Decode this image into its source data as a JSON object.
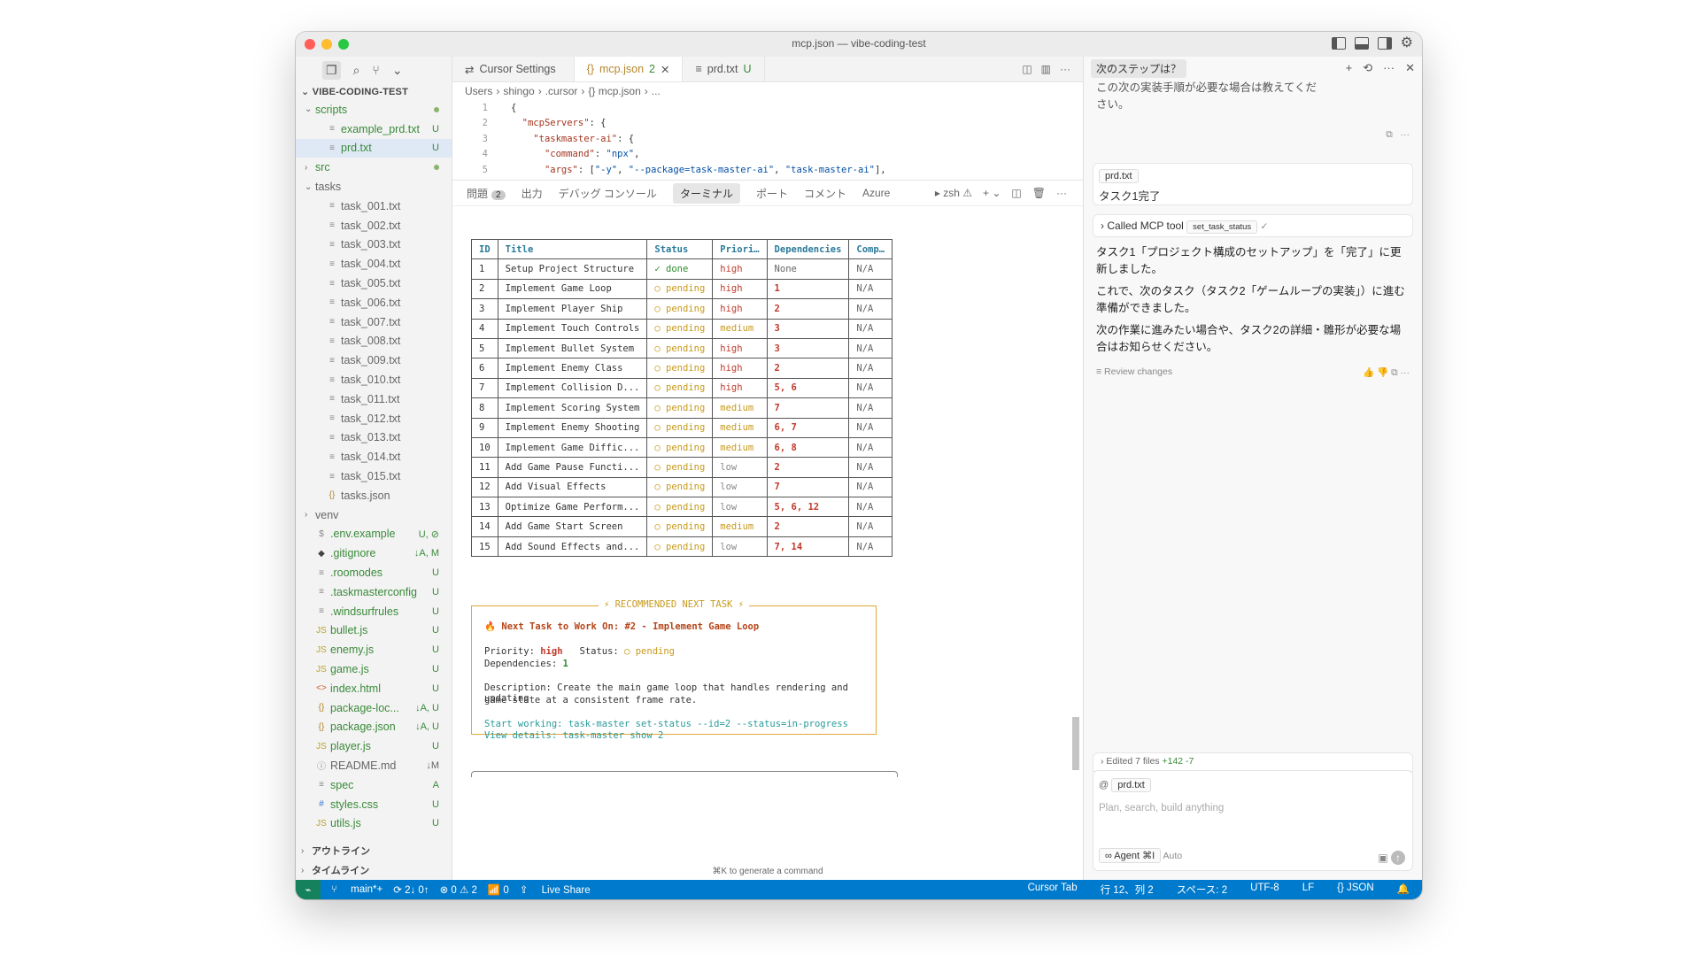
{
  "window": {
    "title": "mcp.json — vibe-coding-test"
  },
  "explorer": {
    "section_title": "VIBE-CODING-TEST",
    "items": [
      {
        "name": "scripts",
        "kind": "folder-open",
        "status": "●",
        "color": "green"
      },
      {
        "name": "example_prd.txt",
        "kind": "file",
        "status": "U",
        "color": "green"
      },
      {
        "name": "prd.txt",
        "kind": "file",
        "status": "U",
        "color": "green",
        "selected": true
      },
      {
        "name": "src",
        "kind": "folder",
        "status": "●",
        "color": "green"
      },
      {
        "name": "tasks",
        "kind": "folder-open",
        "status": "",
        "color": "grey"
      },
      {
        "name": "task_001.txt",
        "kind": "file",
        "status": "",
        "color": "grey"
      },
      {
        "name": "task_002.txt",
        "kind": "file",
        "status": "",
        "color": "grey"
      },
      {
        "name": "task_003.txt",
        "kind": "file",
        "status": "",
        "color": "grey"
      },
      {
        "name": "task_004.txt",
        "kind": "file",
        "status": "",
        "color": "grey"
      },
      {
        "name": "task_005.txt",
        "kind": "file",
        "status": "",
        "color": "grey"
      },
      {
        "name": "task_006.txt",
        "kind": "file",
        "status": "",
        "color": "grey"
      },
      {
        "name": "task_007.txt",
        "kind": "file",
        "status": "",
        "color": "grey"
      },
      {
        "name": "task_008.txt",
        "kind": "file",
        "status": "",
        "color": "grey"
      },
      {
        "name": "task_009.txt",
        "kind": "file",
        "status": "",
        "color": "grey"
      },
      {
        "name": "task_010.txt",
        "kind": "file",
        "status": "",
        "color": "grey"
      },
      {
        "name": "task_011.txt",
        "kind": "file",
        "status": "",
        "color": "grey"
      },
      {
        "name": "task_012.txt",
        "kind": "file",
        "status": "",
        "color": "grey"
      },
      {
        "name": "task_013.txt",
        "kind": "file",
        "status": "",
        "color": "grey"
      },
      {
        "name": "task_014.txt",
        "kind": "file",
        "status": "",
        "color": "grey"
      },
      {
        "name": "task_015.txt",
        "kind": "file",
        "status": "",
        "color": "grey"
      },
      {
        "name": "tasks.json",
        "kind": "json",
        "status": "",
        "color": "grey"
      },
      {
        "name": "venv",
        "kind": "folder",
        "status": "",
        "color": "grey"
      },
      {
        "name": ".env.example",
        "kind": "env",
        "status": "U, ⊘",
        "color": "green"
      },
      {
        "name": ".gitignore",
        "kind": "git",
        "status": "↓A, M",
        "color": "green"
      },
      {
        "name": ".roomodes",
        "kind": "file",
        "status": "U",
        "color": "green"
      },
      {
        "name": ".taskmasterconfig",
        "kind": "file",
        "status": "U",
        "color": "green"
      },
      {
        "name": ".windsurfrules",
        "kind": "file",
        "status": "U",
        "color": "green"
      },
      {
        "name": "bullet.js",
        "kind": "js",
        "status": "U",
        "color": "green"
      },
      {
        "name": "enemy.js",
        "kind": "js",
        "status": "U",
        "color": "green"
      },
      {
        "name": "game.js",
        "kind": "js",
        "status": "U",
        "color": "green"
      },
      {
        "name": "index.html",
        "kind": "html",
        "status": "U",
        "color": "green"
      },
      {
        "name": "package-loc...",
        "kind": "json",
        "status": "↓A, U",
        "color": "green"
      },
      {
        "name": "package.json",
        "kind": "json",
        "status": "↓A, U",
        "color": "green"
      },
      {
        "name": "player.js",
        "kind": "js",
        "status": "U",
        "color": "green"
      },
      {
        "name": "README.md",
        "kind": "info",
        "status": "↓M",
        "color": "grey"
      },
      {
        "name": "spec",
        "kind": "file",
        "status": "A",
        "color": "green"
      },
      {
        "name": "styles.css",
        "kind": "css",
        "status": "U",
        "color": "green"
      },
      {
        "name": "utils.js",
        "kind": "js",
        "status": "U",
        "color": "green"
      }
    ],
    "outline": "アウトライン",
    "timeline": "タイムライン"
  },
  "tabs": [
    {
      "label": "Cursor Settings",
      "icon": "⇄",
      "suffix": "",
      "active": false
    },
    {
      "label": "mcp.json",
      "icon": "{}",
      "suffix": "2",
      "active": true
    },
    {
      "label": "prd.txt",
      "icon": "≡",
      "suffix": "U",
      "active": false
    }
  ],
  "breadcrumb": [
    "Users",
    "shingo",
    ".cursor",
    "{} mcp.json",
    "..."
  ],
  "code_lines": [
    {
      "n": "1",
      "html": "{"
    },
    {
      "n": "2",
      "html": "  <span class='str'>\"mcpServers\"</span>: {"
    },
    {
      "n": "3",
      "html": "    <span class='str'>\"taskmaster-ai\"</span>: {"
    },
    {
      "n": "4",
      "html": "      <span class='str'>\"command\"</span>: <span class='key'>\"npx\"</span>,"
    },
    {
      "n": "5",
      "html": "      <span class='str'>\"args\"</span>: [<span class='key'>\"-y\"</span>, <span class='key'>\"--package=task-master-ai\"</span>, <span class='key'>\"task-master-ai\"</span>],"
    },
    {
      "n": "6",
      "html": "      <span class='str'>\"env\"</span>: {"
    }
  ],
  "panel": {
    "tabs": [
      "問題",
      "出力",
      "デバッグ コンソール",
      "ターミナル",
      "ポート",
      "コメント",
      "Azure"
    ],
    "problems_count": "2",
    "active": "ターミナル",
    "shell": "zsh"
  },
  "task_table": {
    "headers": [
      "ID",
      "Title",
      "Status",
      "Priori…",
      "Dependencies",
      "Comp…"
    ],
    "rows": [
      [
        "1",
        "Setup Project Structure",
        "✓ done",
        "high",
        "None",
        "N/A"
      ],
      [
        "2",
        "Implement Game Loop",
        "○ pending",
        "high",
        "1",
        "N/A"
      ],
      [
        "3",
        "Implement Player Ship",
        "○ pending",
        "high",
        "2",
        "N/A"
      ],
      [
        "4",
        "Implement Touch Controls",
        "○ pending",
        "medium",
        "3",
        "N/A"
      ],
      [
        "5",
        "Implement Bullet System",
        "○ pending",
        "high",
        "3",
        "N/A"
      ],
      [
        "6",
        "Implement Enemy Class",
        "○ pending",
        "high",
        "2",
        "N/A"
      ],
      [
        "7",
        "Implement Collision D...",
        "○ pending",
        "high",
        "5, 6",
        "N/A"
      ],
      [
        "8",
        "Implement Scoring System",
        "○ pending",
        "medium",
        "7",
        "N/A"
      ],
      [
        "9",
        "Implement Enemy Shooting",
        "○ pending",
        "medium",
        "6, 7",
        "N/A"
      ],
      [
        "10",
        "Implement Game Diffic...",
        "○ pending",
        "medium",
        "6, 8",
        "N/A"
      ],
      [
        "11",
        "Add Game Pause Functi...",
        "○ pending",
        "low",
        "2",
        "N/A"
      ],
      [
        "12",
        "Add Visual Effects",
        "○ pending",
        "low",
        "7",
        "N/A"
      ],
      [
        "13",
        "Optimize Game Perform...",
        "○ pending",
        "low",
        "5, 6, 12",
        "N/A"
      ],
      [
        "14",
        "Add Game Start Screen",
        "○ pending",
        "medium",
        "2",
        "N/A"
      ],
      [
        "15",
        "Add Sound Effects and...",
        "○ pending",
        "low",
        "7, 14",
        "N/A"
      ]
    ]
  },
  "recommended": {
    "title": "⚡ RECOMMENDED NEXT TASK ⚡",
    "next": "🔥 Next Task to Work On: #2 - Implement Game Loop",
    "priority_label": "Priority:",
    "priority": "high",
    "status_label": "Status:",
    "status": "○ pending",
    "deps_label": "Dependencies:",
    "deps": "1",
    "desc1": "Description: Create the main game loop that handles rendering and updating",
    "desc2": "game state at a consistent frame rate.",
    "start": "Start working: task-master set-status --id=2 --status=in-progress",
    "view": "View details: task-master show 2"
  },
  "terminal_hint": "⌘K to generate a command",
  "chat": {
    "tab": "次のステップは？",
    "top_text1": "この次の実装手順が必要な場合は教えてくだ",
    "top_text2": "さい。",
    "file_chip": "prd.txt",
    "user_msg": "タスク1完了",
    "tool_label": "Called MCP tool",
    "tool_name": "set_task_status",
    "p1a": "タスク1「プロジェクト構成のセットアップ」を「完了」に更",
    "p1b": "新しました。",
    "p2a": "これで、次のタスク（タスク2「ゲームループの実装」）に進む",
    "p2b": "準備ができました。",
    "p3a": "次の作業に進みたい場合や、タスク2の詳細・雛形が必要な場",
    "p3b": "合はお知らせください。",
    "review": "Review changes",
    "edited": "Edited 7 files",
    "diff": "+142 -7",
    "context_chip": "prd.txt",
    "placeholder": "Plan, search, build anything",
    "mode": "∞ Agent ⌘I",
    "model": "Auto"
  },
  "statusbar": {
    "branch": "main*+",
    "sync": "⟳ 2↓ 0↑",
    "errors": "⊗ 0 ⚠ 2",
    "ports": "📶 0",
    "liveshare": "Live Share",
    "cursor_tab": "Cursor Tab",
    "position": "行 12、列 2",
    "spaces": "スペース: 2",
    "encoding": "UTF-8",
    "eol": "LF",
    "lang": "{} JSON"
  },
  "colors": {
    "accent": "#007acc",
    "green": "#3a8a3a",
    "border": "#e0a83a"
  }
}
